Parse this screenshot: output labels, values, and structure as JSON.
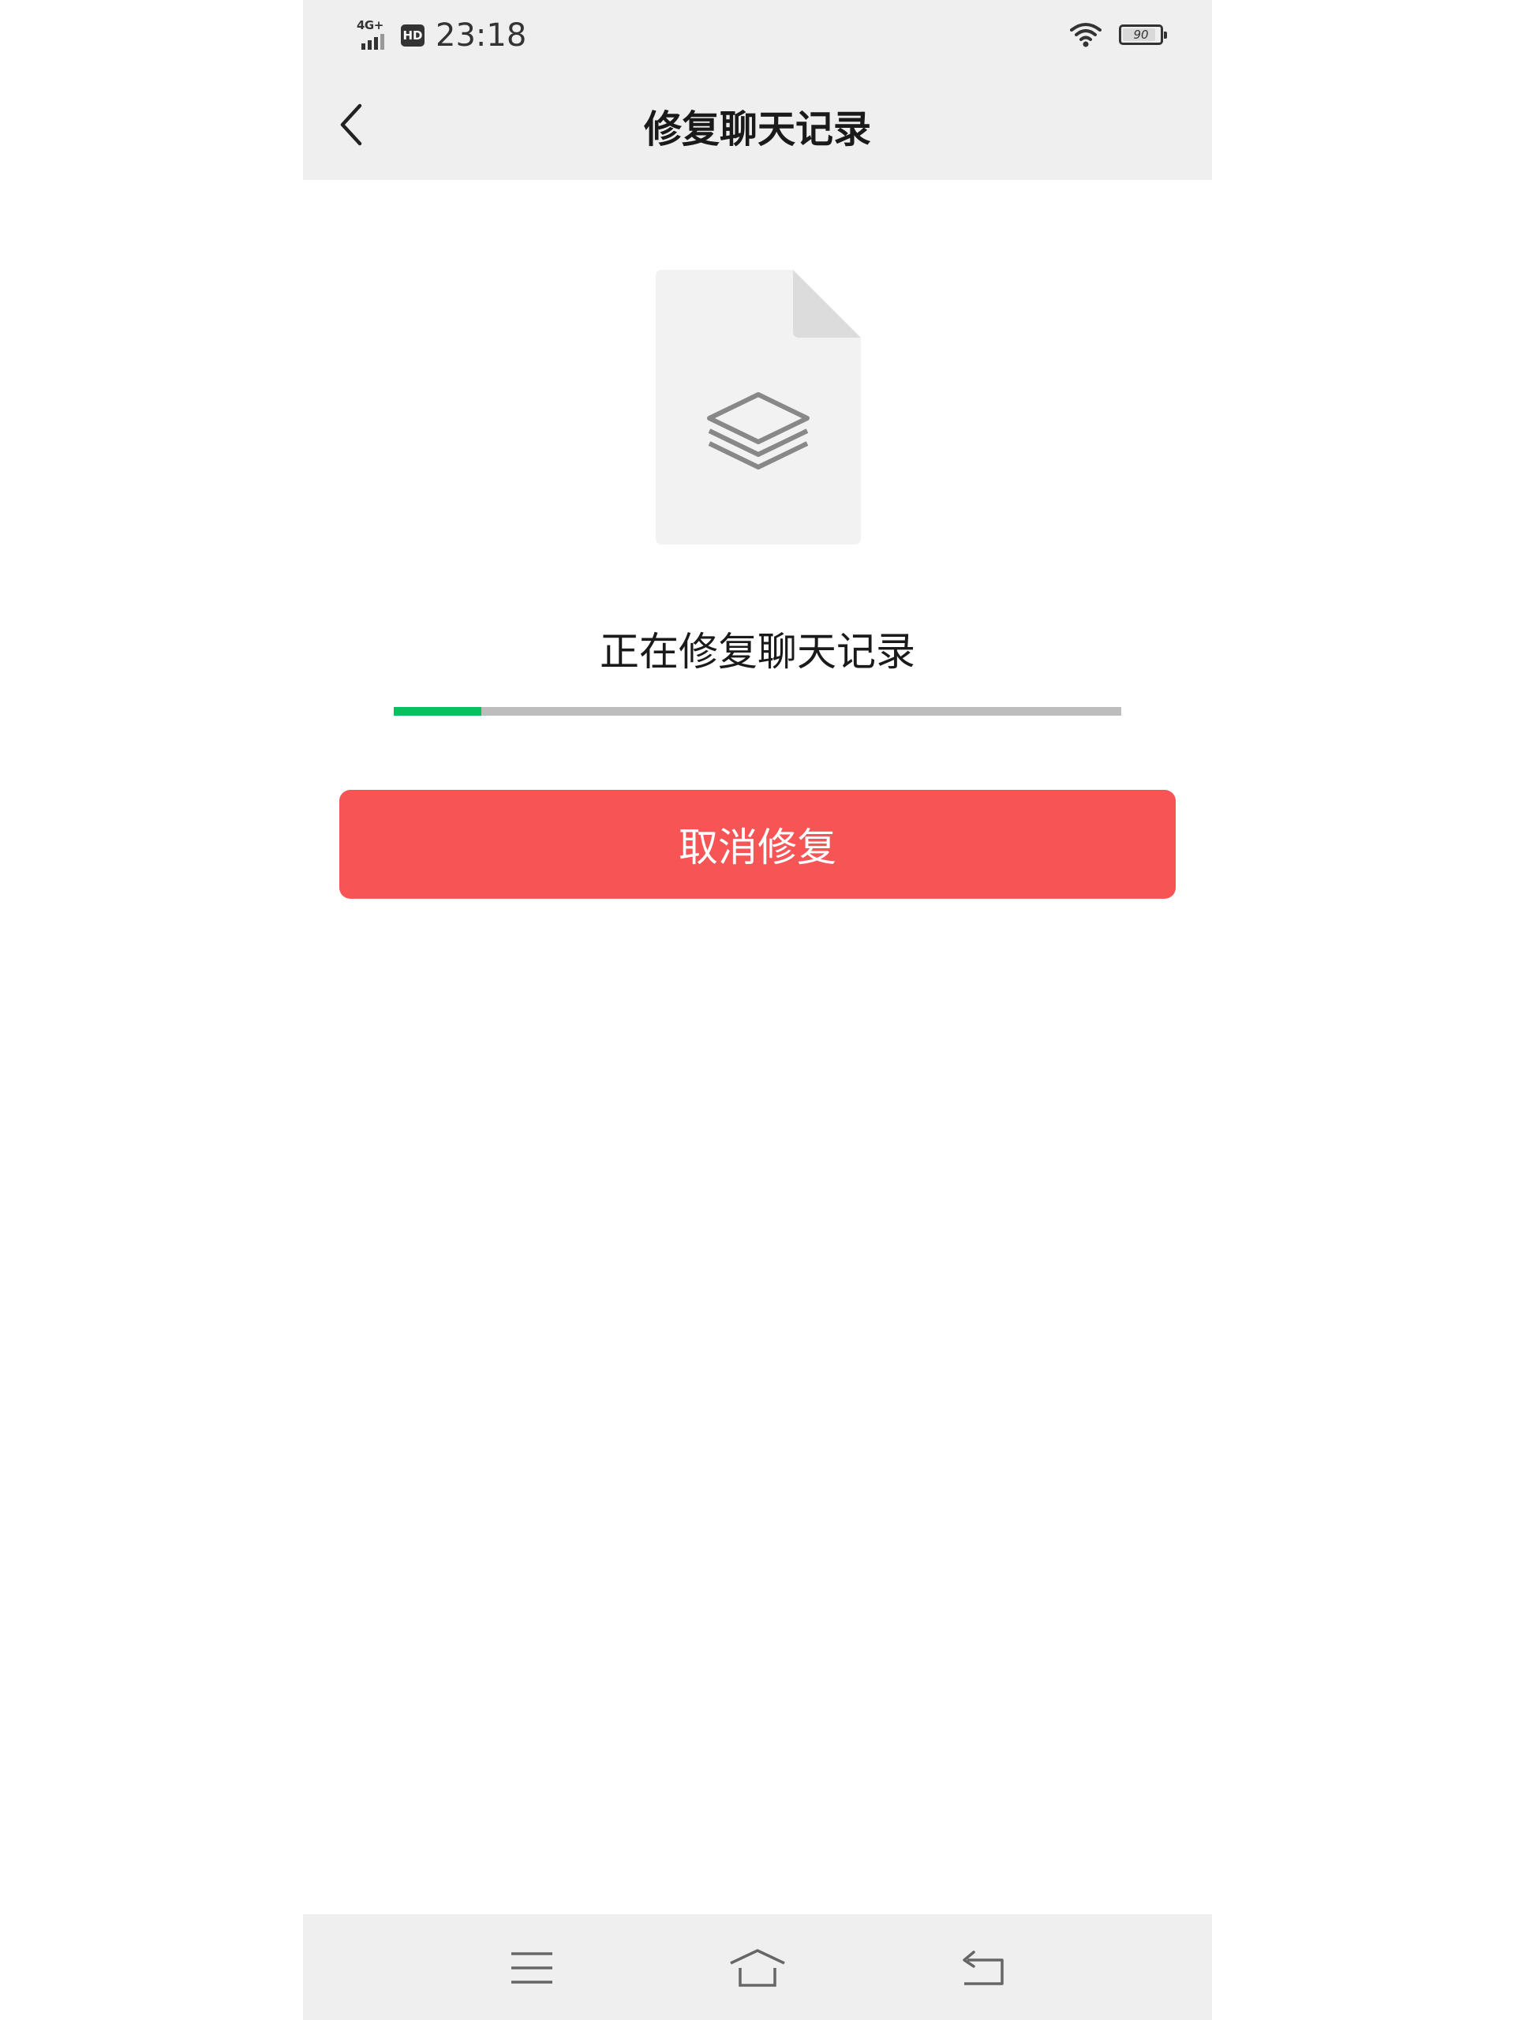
{
  "status_bar": {
    "network": "4G+",
    "hd": "HD",
    "time": "23:18",
    "battery": 90
  },
  "nav": {
    "title": "修复聊天记录"
  },
  "main": {
    "status_text": "正在修复聊天记录",
    "progress": 0.12,
    "cancel_label": "取消修复"
  },
  "colors": {
    "progress_fill": "#07c160",
    "progress_track": "#bdbdbd",
    "cancel_button": "#f75555"
  },
  "icons": {
    "back": "chevron-left-icon",
    "document": "document-icon",
    "layers": "layers-icon",
    "menu": "menu-icon",
    "home": "home-icon",
    "return": "return-icon"
  }
}
